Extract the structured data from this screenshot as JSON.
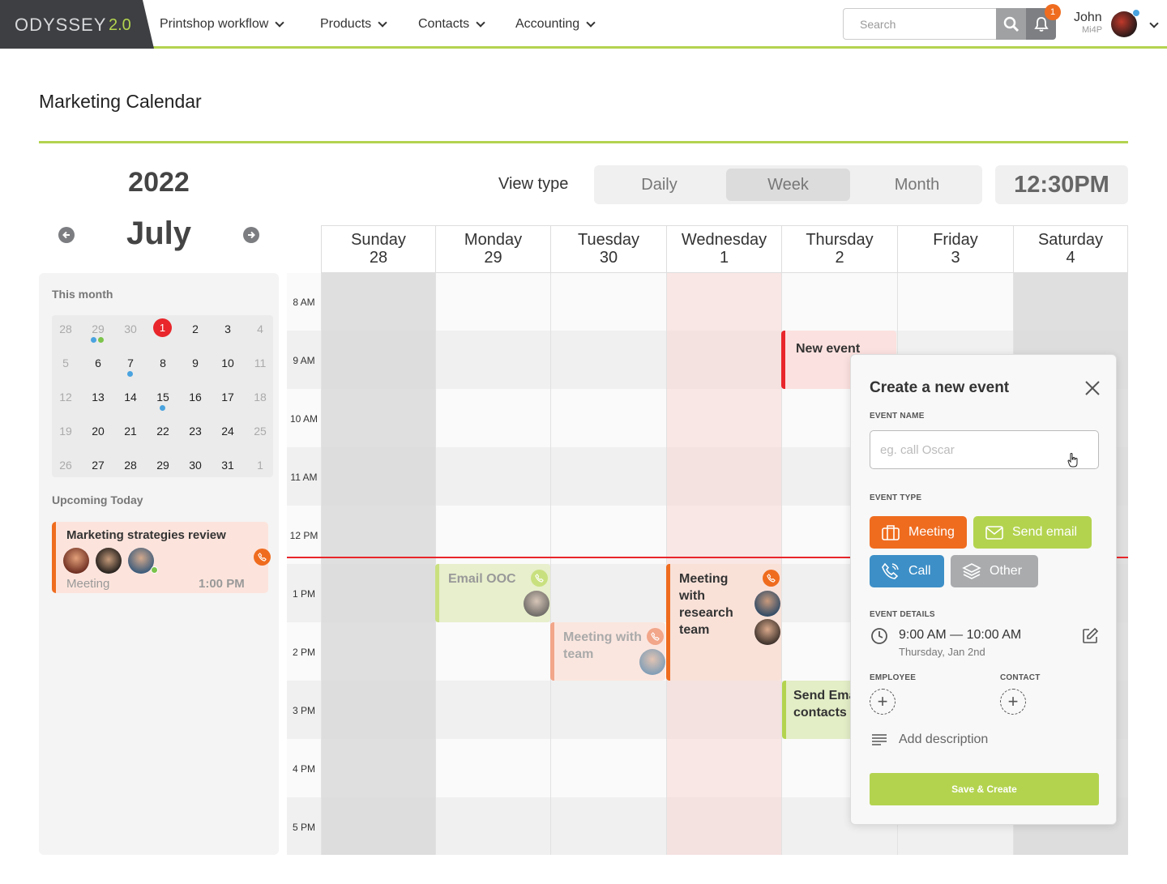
{
  "app": {
    "logo": "ODYSSEY",
    "version": "2.0"
  },
  "nav": [
    {
      "label": "Printshop workflow"
    },
    {
      "label": "Products"
    },
    {
      "label": "Contacts"
    },
    {
      "label": "Accounting"
    }
  ],
  "search": {
    "placeholder": "Search"
  },
  "notifications": {
    "count": "1"
  },
  "user": {
    "name": "John",
    "org": "Mi4P"
  },
  "page": {
    "title": "Marketing Calendar"
  },
  "calendar": {
    "year": "2022",
    "month": "July",
    "view_label": "View type",
    "views": [
      "Daily",
      "Week",
      "Month"
    ],
    "active_view": "Week",
    "clock": "12:30PM",
    "week_days": [
      {
        "name": "Sunday",
        "date": "28"
      },
      {
        "name": "Monday",
        "date": "29"
      },
      {
        "name": "Tuesday",
        "date": "30"
      },
      {
        "name": "Wednesday",
        "date": "1"
      },
      {
        "name": "Thursday",
        "date": "2"
      },
      {
        "name": "Friday",
        "date": "3"
      },
      {
        "name": "Saturday",
        "date": "4"
      }
    ],
    "hours": [
      "8 AM",
      "9 AM",
      "10 AM",
      "11 AM",
      "12 PM",
      "1 PM",
      "2 PM",
      "3 PM",
      "4 PM",
      "5 PM"
    ],
    "events": {
      "new_event": "New event",
      "email_ooc": "Email OOC",
      "meeting_team": "Meeting with team",
      "meeting_research": "Meeting with research team",
      "send_email": "Send Email to contacts"
    }
  },
  "sidebar": {
    "this_month": "This month",
    "mini_calendar": [
      [
        "28",
        "29",
        "30",
        "1",
        "2",
        "3",
        "4"
      ],
      [
        "5",
        "6",
        "7",
        "8",
        "9",
        "10",
        "11"
      ],
      [
        "12",
        "13",
        "14",
        "15",
        "16",
        "17",
        "18"
      ],
      [
        "19",
        "20",
        "21",
        "22",
        "23",
        "24",
        "25"
      ],
      [
        "26",
        "27",
        "28",
        "29",
        "30",
        "31",
        "1"
      ]
    ],
    "upcoming_today": "Upcoming Today",
    "upcoming": {
      "title": "Marketing strategies review",
      "type": "Meeting",
      "time": "1:00 PM"
    }
  },
  "modal": {
    "title": "Create a new event",
    "event_name_label": "EVENT NAME",
    "event_name_placeholder": "eg. call Oscar",
    "event_type_label": "EVENT TYPE",
    "types": {
      "meeting": "Meeting",
      "send_email": "Send email",
      "call": "Call",
      "other": "Other"
    },
    "details_label": "EVENT DETAILS",
    "time_range": "9:00 AM — 10:00 AM",
    "date": "Thursday, Jan 2nd",
    "employee_label": "EMPLOYEE",
    "contact_label": "CONTACT",
    "description": "Add description",
    "save": "Save & Create"
  },
  "colors": {
    "accent": "#b3d34f",
    "meeting": "#ef6c1f",
    "call": "#3d8fc7",
    "other": "#a9abad",
    "today": "#e8262b"
  }
}
